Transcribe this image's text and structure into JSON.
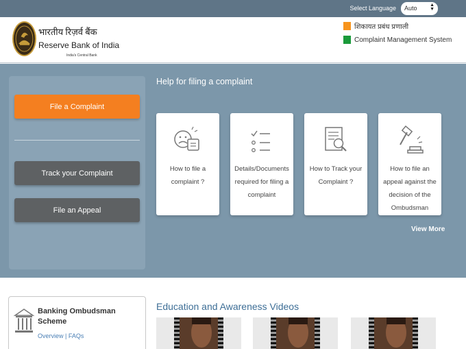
{
  "topbar": {
    "language_label": "Select Language",
    "language_value": "Auto"
  },
  "header": {
    "rbi_hindi": "भारतीय रिज़र्व बैंक",
    "rbi_english": "Reserve Bank of India",
    "rbi_tagline": "India's Central Bank",
    "cms_hindi": "शिकायत प्रबंध प्रणाली",
    "cms_english": "Complaint Management System",
    "cms_hindi_color": "#f7941d",
    "cms_english_color": "#1a9a3a"
  },
  "sidebar": {
    "file_complaint": "File a Complaint",
    "track_complaint": "Track your Complaint",
    "file_appeal": "File an Appeal"
  },
  "help": {
    "title": "Help for filing a complaint",
    "cards": [
      {
        "label": "How to file a complaint ?",
        "icon": "complaint-chat-icon"
      },
      {
        "label": "Details/Documents required for filing a complaint",
        "icon": "checklist-icon"
      },
      {
        "label": "How to Track your Complaint ?",
        "icon": "document-search-icon"
      },
      {
        "label": "How to file an appeal against the decision of the Ombudsman",
        "icon": "gavel-icon"
      }
    ],
    "view_more": "View More"
  },
  "ombudsman": {
    "title": "Banking Ombudsman Scheme",
    "link_overview": "Overview",
    "link_sep": "|",
    "link_faqs": "FAQs"
  },
  "education": {
    "title": "Education and Awareness Videos"
  },
  "colors": {
    "topbar": "#5f7587",
    "hero": "#7c97aa",
    "accent_orange": "#f47f20",
    "button_dark": "#5e6163"
  }
}
